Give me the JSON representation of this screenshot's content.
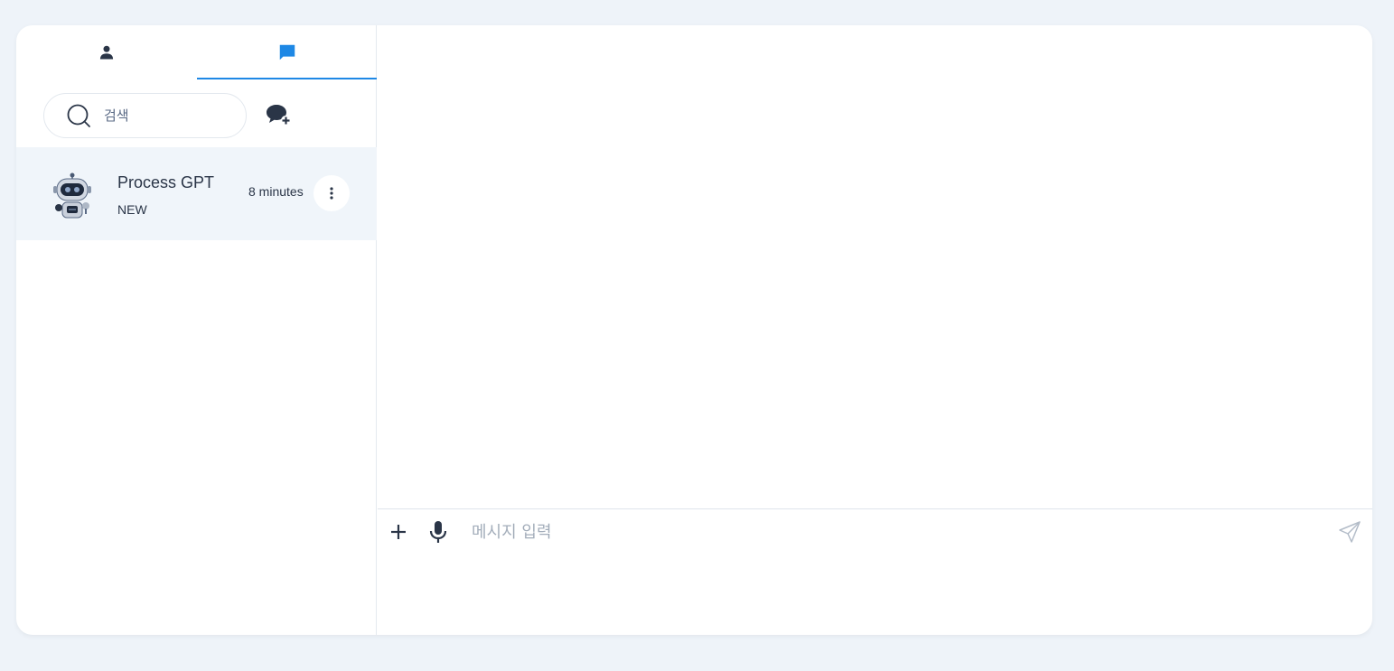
{
  "tabs": [
    {
      "icon": "person-icon"
    },
    {
      "icon": "chat-icon",
      "active": true
    }
  ],
  "search": {
    "placeholder": "검색",
    "icon": "search-icon"
  },
  "new_chat": {
    "icon": "chat-add-icon"
  },
  "chat_list": [
    {
      "name": "Process GPT",
      "subtitle": "NEW",
      "time": "8 minutes",
      "avatar": "robot-avatar"
    }
  ],
  "composer": {
    "placeholder": "메시지 입력",
    "attach_icon": "plus-icon",
    "mic_icon": "microphone-icon",
    "send_icon": "send-icon"
  },
  "colors": {
    "page_bg": "#eef3f9",
    "accent": "#1e88e5",
    "selected_row": "#f0f5fa",
    "text": "#2a3547"
  }
}
